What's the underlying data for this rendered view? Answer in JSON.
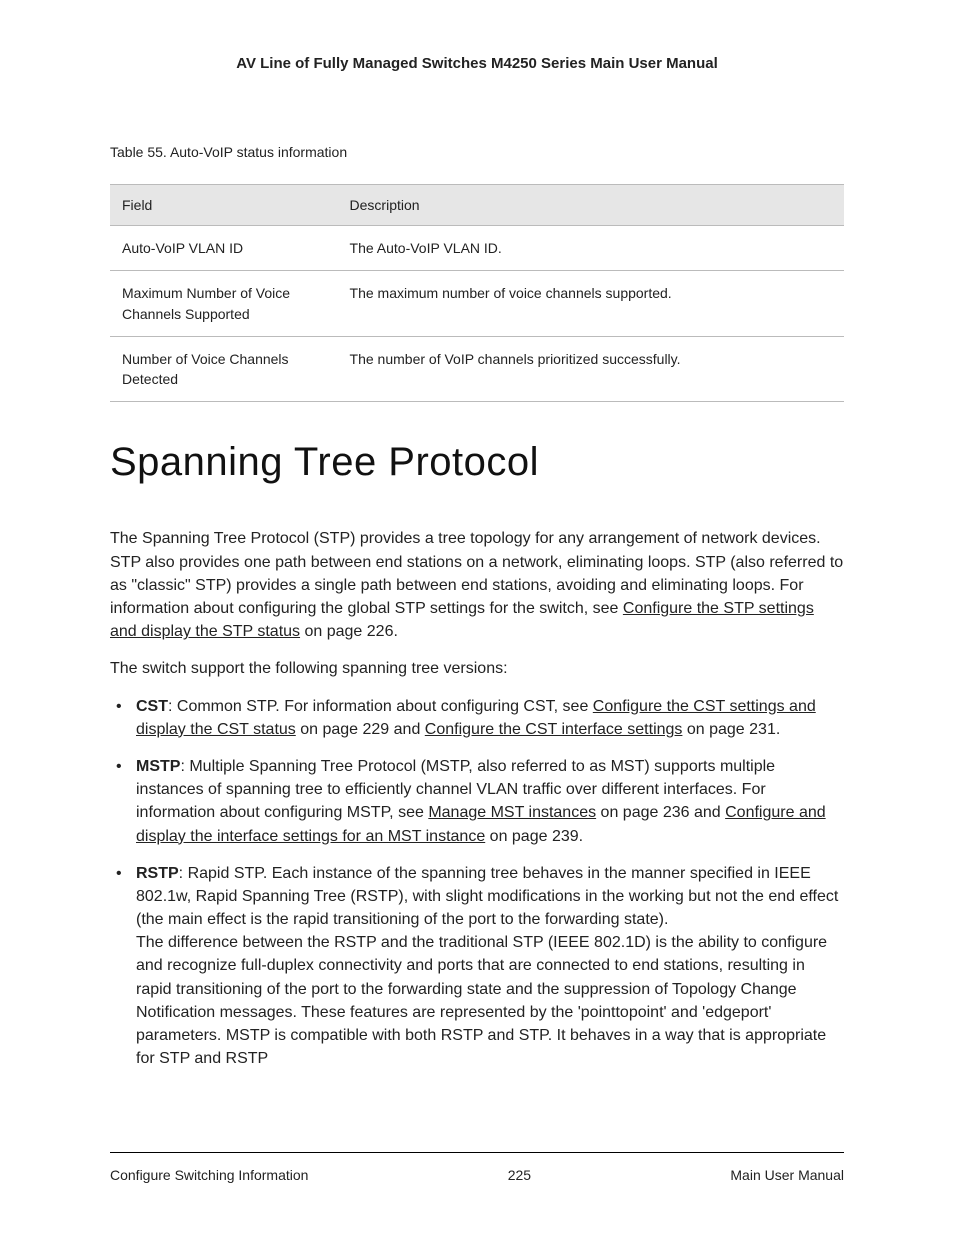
{
  "header": {
    "title": "AV Line of Fully Managed Switches M4250 Series Main User Manual"
  },
  "table": {
    "caption": "Table 55. Auto-VoIP status information",
    "columns": {
      "field": "Field",
      "description": "Description"
    },
    "rows": [
      {
        "field": "Auto-VoIP VLAN ID",
        "description": "The Auto-VoIP VLAN ID."
      },
      {
        "field": "Maximum Number of Voice Channels Supported",
        "description": "The maximum number of voice channels supported."
      },
      {
        "field": "Number of Voice Channels Detected",
        "description": "The number of VoIP channels prioritized successfully."
      }
    ]
  },
  "section": {
    "heading": "Spanning Tree Protocol",
    "para1_a": "The Spanning Tree Protocol (STP) provides a tree topology for any arrangement of network devices. STP also provides one path between end stations on a network, eliminating loops. STP (also referred to as \"classic\" STP) provides a single path between end stations, avoiding and eliminating loops. For information about configuring the global STP settings for the switch, see ",
    "para1_link": "Configure the STP settings and display the STP status",
    "para1_b": " on page 226.",
    "para2": "The switch support the following spanning tree versions:",
    "cst": {
      "bold": "CST",
      "t1": ": Common STP. For information about configuring CST, see ",
      "link1": "Configure the CST settings and display the CST status",
      "t2": " on page 229 and ",
      "link2": "Configure the CST interface settings",
      "t3": " on page 231."
    },
    "mstp": {
      "bold": "MSTP",
      "t1": ": Multiple Spanning Tree Protocol (MSTP, also referred to as MST) supports multiple instances of spanning tree to efficiently channel VLAN traffic over different interfaces. For information about configuring MSTP, see ",
      "link1": "Manage MST instances",
      "t2": " on page 236 and ",
      "link2": "Configure and display the interface settings for an MST instance",
      "t3": " on page 239."
    },
    "rstp": {
      "bold": "RSTP",
      "t1": ": Rapid STP. Each instance of the spanning tree behaves in the manner specified in IEEE 802.1w, Rapid Spanning Tree (RSTP), with slight modifications in the working but not the end effect (the main effect is the rapid transitioning of the port to the forwarding state).",
      "t2": "The difference between the RSTP and the traditional STP (IEEE 802.1D) is the ability to configure and recognize full-duplex connectivity and ports that are connected to end stations, resulting in rapid transitioning of the port to the forwarding state and the suppression of Topology Change Notification messages. These features are represented by the 'pointtopoint' and 'edgeport' parameters. MSTP is compatible with both RSTP and STP. It behaves in a way that is appropriate for STP and RSTP"
    }
  },
  "footer": {
    "left": "Configure Switching Information",
    "center": "225",
    "right": "Main User Manual"
  }
}
